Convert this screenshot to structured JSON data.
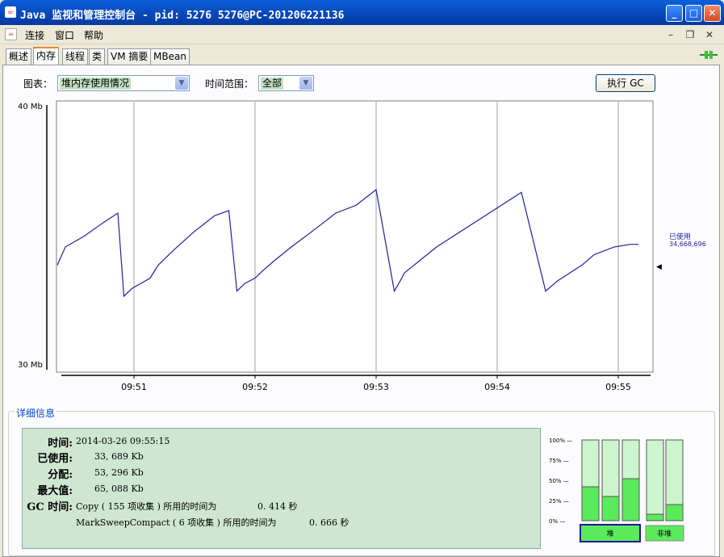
{
  "window": {
    "title": "Java 监视和管理控制台 - pid: 5276 5276@PC-201206221136"
  },
  "menu": [
    "连接",
    "窗口",
    "帮助"
  ],
  "tabs": [
    "概述",
    "内存",
    "线程",
    "类",
    "VM 摘要",
    "MBean"
  ],
  "active_tab": "内存",
  "controls": {
    "chart_label": "图表：",
    "chart_value": "堆内存使用情况",
    "range_label": "时间范围：",
    "range_value": "全部",
    "gc_button": "执行 GC"
  },
  "chart_data": {
    "type": "line",
    "title": "",
    "ylim_labels": [
      "40 Mb",
      "30 Mb"
    ],
    "ylim": [
      30,
      40
    ],
    "x_ticks": [
      "09:51",
      "09:52",
      "09:53",
      "09:54",
      "09:55"
    ],
    "series": [
      {
        "name": "已使用",
        "last_label": "34,668,696",
        "x": [
          "09:50:22",
          "09:50:26",
          "09:50:35",
          "09:50:46",
          "09:50:52",
          "09:50:55",
          "09:50:59",
          "09:51:08",
          "09:51:12",
          "09:51:20",
          "09:51:30",
          "09:51:40",
          "09:51:47",
          "09:51:51",
          "09:51:55",
          "09:52:00",
          "09:52:04",
          "09:52:10",
          "09:52:18",
          "09:52:30",
          "09:52:40",
          "09:52:50",
          "09:53:00",
          "09:53:09",
          "09:53:12",
          "09:53:14",
          "09:53:22",
          "09:53:30",
          "09:53:40",
          "09:53:52",
          "09:54:02",
          "09:54:12",
          "09:54:24",
          "09:54:30",
          "09:54:36",
          "09:54:42",
          "09:54:48",
          "09:54:58",
          "09:55:06",
          "09:55:10"
        ],
        "values": [
          33.9,
          34.6,
          35.0,
          35.6,
          35.9,
          32.7,
          33.0,
          33.4,
          33.9,
          34.5,
          35.2,
          35.8,
          36.0,
          32.9,
          33.2,
          33.4,
          33.7,
          34.1,
          34.6,
          35.3,
          35.9,
          36.2,
          36.8,
          32.9,
          33.3,
          33.6,
          34.1,
          34.6,
          35.1,
          35.7,
          36.2,
          36.7,
          32.9,
          33.3,
          33.6,
          33.9,
          34.3,
          34.6,
          34.7,
          34.7
        ]
      }
    ]
  },
  "details": {
    "title": "详细信息",
    "time_label": "时间:",
    "time_value": "2014-03-26 09:55:15",
    "used_label": "已使用:",
    "used_value": "33, 689 Kb",
    "committed_label": "分配:",
    "committed_value": "53, 296 Kb",
    "max_label": "最大值:",
    "max_value": "65, 088 Kb",
    "gc_label": "GC 时间:",
    "gc1_text": "Copy ( 155 项收集 ) 所用的时间为",
    "gc1_time": "0. 414 秒",
    "gc2_text": "MarkSweepCompact ( 6 项收集 ) 所用的时间为",
    "gc2_time": "0. 666 秒"
  },
  "bars": {
    "scale": [
      "100% —",
      "75% —",
      "50% —",
      "25% —",
      "0% —"
    ],
    "heap_levels": [
      0.42,
      0.3,
      0.52
    ],
    "nonheap_levels": [
      0.08,
      0.2
    ],
    "heap_label": "堆",
    "nonheap_label": "非堆",
    "fill": "#5bea5b",
    "empty": "#cdf5cd"
  }
}
